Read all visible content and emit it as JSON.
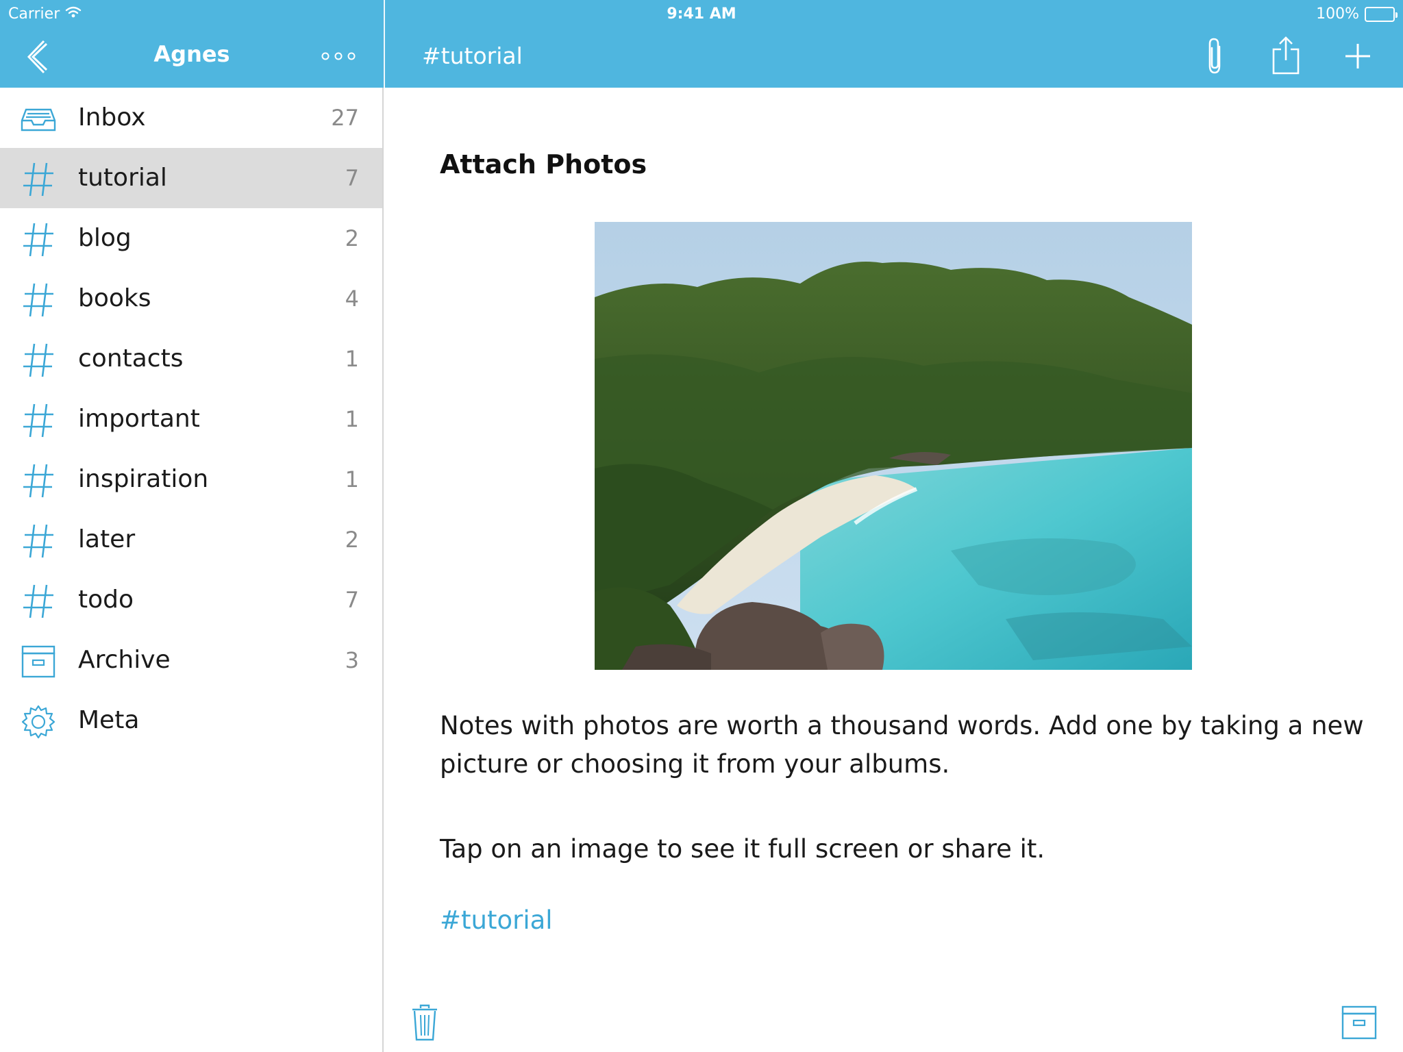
{
  "status_bar": {
    "carrier": "Carrier",
    "time": "9:41 AM",
    "battery": "100%",
    "battery_level": 1.0
  },
  "sidebar_header": {
    "title": "Agnes",
    "back_icon": "chevron-left-icon",
    "more_icon": "more-dots-icon"
  },
  "note_header": {
    "tag": "#tutorial",
    "actions": [
      "paperclip-icon",
      "share-icon",
      "plus-icon"
    ]
  },
  "sidebar": {
    "items": [
      {
        "icon": "inbox-icon",
        "label": "Inbox",
        "count": "27",
        "selected": false
      },
      {
        "icon": "hash-icon",
        "label": "tutorial",
        "count": "7",
        "selected": true
      },
      {
        "icon": "hash-icon",
        "label": "blog",
        "count": "2",
        "selected": false
      },
      {
        "icon": "hash-icon",
        "label": "books",
        "count": "4",
        "selected": false
      },
      {
        "icon": "hash-icon",
        "label": "contacts",
        "count": "1",
        "selected": false
      },
      {
        "icon": "hash-icon",
        "label": "important",
        "count": "1",
        "selected": false
      },
      {
        "icon": "hash-icon",
        "label": "inspiration",
        "count": "1",
        "selected": false
      },
      {
        "icon": "hash-icon",
        "label": "later",
        "count": "2",
        "selected": false
      },
      {
        "icon": "hash-icon",
        "label": "todo",
        "count": "7",
        "selected": false
      },
      {
        "icon": "archive-icon",
        "label": "Archive",
        "count": "3",
        "selected": false
      },
      {
        "icon": "gear-icon",
        "label": "Meta",
        "count": "",
        "selected": false
      }
    ]
  },
  "note": {
    "title": "Attach Photos",
    "image": "tropical-beach-photo",
    "paragraph1": "Notes with photos are worth a thousand words. Add one by taking a new picture or choosing it from your albums.",
    "paragraph2": "Tap on an image to see it full screen or share it.",
    "tag_link": "#tutorial"
  },
  "footer": {
    "left_icon": "trash-icon",
    "right_icon": "archive-icon"
  },
  "colors": {
    "header": "#4fb6df",
    "accent": "#3ba7d6",
    "selected_row": "#dcdcdc",
    "count_text": "#8a8a8a"
  }
}
